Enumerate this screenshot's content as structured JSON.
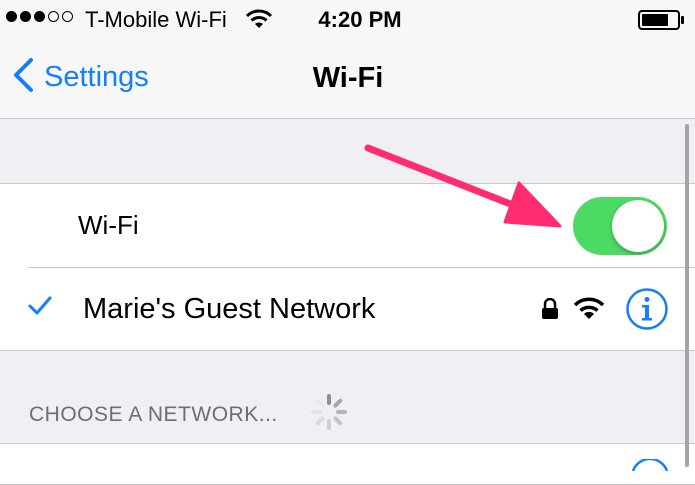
{
  "status_bar": {
    "carrier": "T-Mobile Wi-Fi",
    "time": "4:20 PM",
    "signal_filled": 3,
    "signal_total": 5,
    "icons": {
      "wifi": "wifi-icon",
      "battery": "battery-icon"
    }
  },
  "nav": {
    "back_label": "Settings",
    "title": "Wi-Fi",
    "back_icon": "chevron-left-icon"
  },
  "wifi_toggle": {
    "label": "Wi-Fi",
    "on": true
  },
  "connected_network": {
    "name": "Marie's Guest Network",
    "secured": true,
    "icons": [
      "checkmark-icon",
      "lock-icon",
      "wifi-signal-icon",
      "info-icon"
    ]
  },
  "choose_network": {
    "header": "CHOOSE A NETWORK...",
    "loading": true
  },
  "colors": {
    "accent": "#147efb",
    "toggle_on": "#4cd964",
    "annotation_arrow": "#ff2d6f",
    "background": "#efeff4"
  }
}
